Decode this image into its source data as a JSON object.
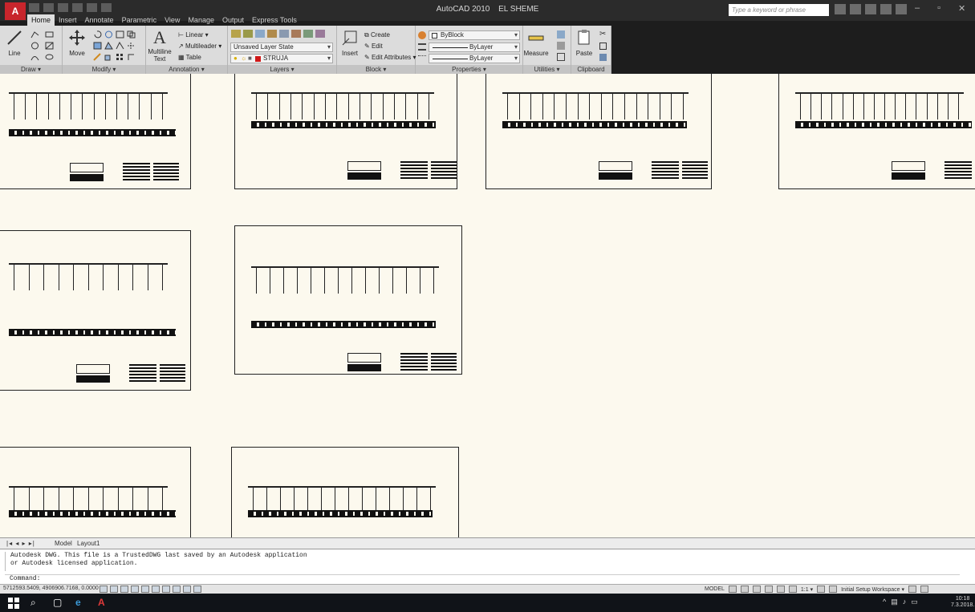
{
  "window": {
    "app_name": "AutoCAD 2010",
    "doc_name": "EL SHEME",
    "search_placeholder": "Type a keyword or phrase",
    "minimize": "–",
    "maximize": "▫",
    "close": "✕"
  },
  "tabs": [
    "Home",
    "Insert",
    "Annotate",
    "Parametric",
    "View",
    "Manage",
    "Output",
    "Express Tools"
  ],
  "ribbon": {
    "draw": {
      "title": "Draw ▾",
      "line": "Line"
    },
    "modify": {
      "title": "Modify ▾",
      "move": "Move"
    },
    "annotation": {
      "title": "Annotation ▾",
      "text1": "Multiline",
      "text2": "Text",
      "linear": "Linear ▾",
      "multileader": "Multileader ▾",
      "table": "Table"
    },
    "layers": {
      "title": "Layers ▾",
      "layer_state": "Unsaved Layer State",
      "current_layer": "STRUJA"
    },
    "block": {
      "title": "Block ▾",
      "insert": "Insert",
      "create": "Create",
      "edit": "Edit",
      "edit_attributes": "Edit Attributes ▾"
    },
    "properties": {
      "title": "Properties ▾",
      "color": "ByBlock",
      "linetype": "ByLayer",
      "lineweight": "ByLayer"
    },
    "utilities": {
      "title": "Utilities ▾",
      "measure": "Measure"
    },
    "clipboard": {
      "title": "Clipboard",
      "paste": "Paste"
    }
  },
  "layout_tabs": {
    "arrows": "|◂ ◂ ▸ ▸|",
    "model": "Model",
    "layout1": "Layout1"
  },
  "command": {
    "history_1": "Autodesk DWG.  This file is a TrustedDWG last saved by an Autodesk application",
    "history_2": "or Autodesk licensed application.",
    "prompt": "Command:"
  },
  "status": {
    "coords": "5712593.5409, 4906906.7168, 0.0000",
    "model": "MODEL",
    "scale": "1:1 ▾",
    "workspace": "Initial Setup Workspace ▾"
  },
  "taskbar": {
    "time": "10:18",
    "date": "7.3.2018."
  },
  "colors": {
    "canvas_bg": "#fcf9ee",
    "app_red": "#c8252c",
    "layer_swatch": "#d01818"
  }
}
